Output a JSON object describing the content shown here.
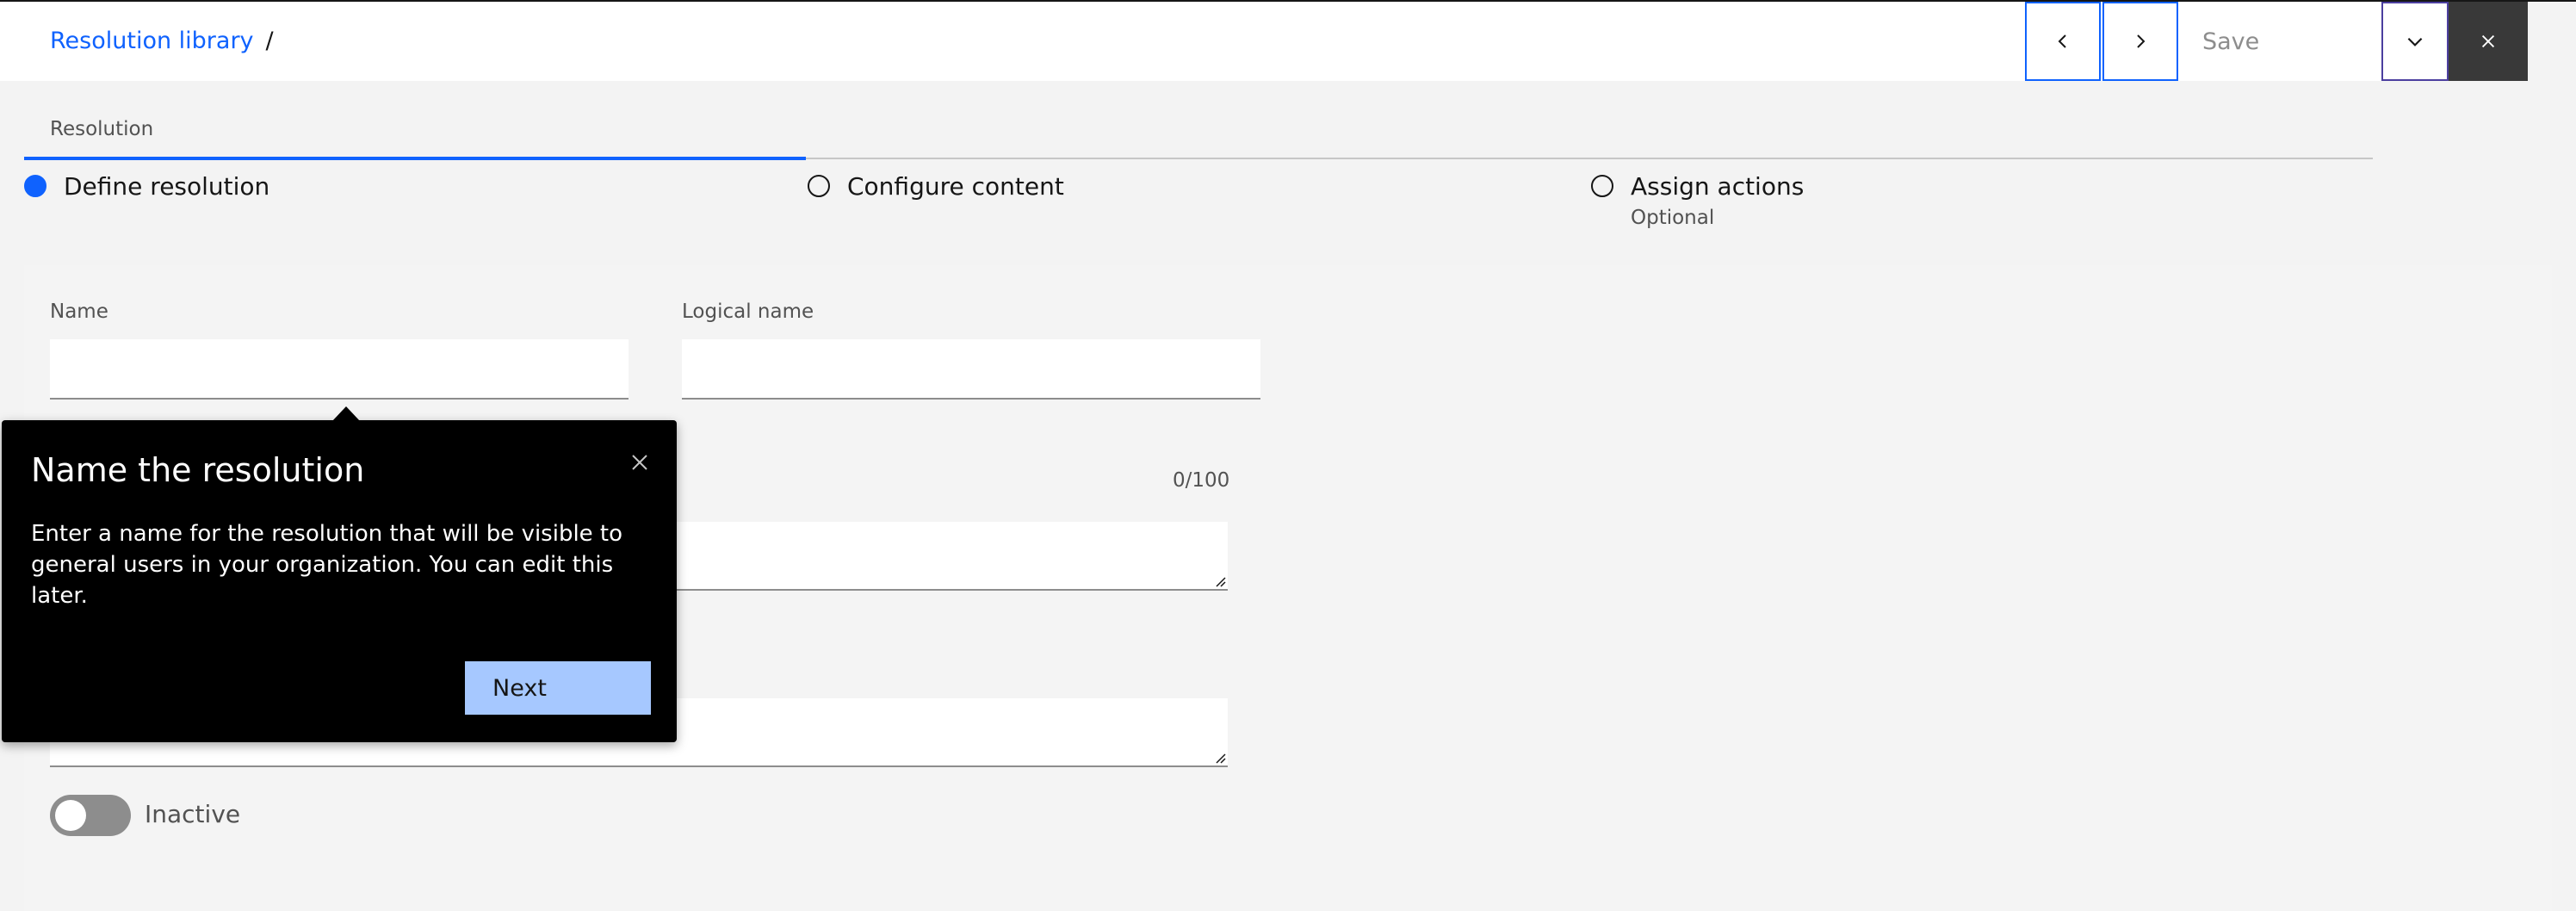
{
  "header": {
    "breadcrumb_link": "Resolution library",
    "breadcrumb_separator": "/",
    "prev_icon": "chevron-left-icon",
    "next_icon": "chevron-right-icon",
    "save_label": "Save",
    "dropdown_icon": "chevron-down-icon",
    "close_icon": "close-icon"
  },
  "progress": {
    "section_label": "Resolution",
    "steps": [
      {
        "label": "Define resolution",
        "sublabel": "",
        "state": "current"
      },
      {
        "label": "Configure content",
        "sublabel": "",
        "state": "incomplete"
      },
      {
        "label": "Assign actions",
        "sublabel": "Optional",
        "state": "incomplete"
      }
    ]
  },
  "form": {
    "name_label": "Name",
    "name_value": "",
    "logical_name_label": "Logical name",
    "logical_name_value": "",
    "description_counter": "0/100",
    "toggle_label": "Inactive",
    "toggle_on": false
  },
  "popover": {
    "title": "Name the resolution",
    "body": "Enter a name for the resolution that will be visible to general users in your organization. You can edit this later.",
    "next_label": "Next",
    "close_icon": "close-icon"
  },
  "colors": {
    "accent": "#0f62fe",
    "popover_bg": "#000000",
    "next_button": "#a6c8ff",
    "close_button_bg": "#393939"
  }
}
